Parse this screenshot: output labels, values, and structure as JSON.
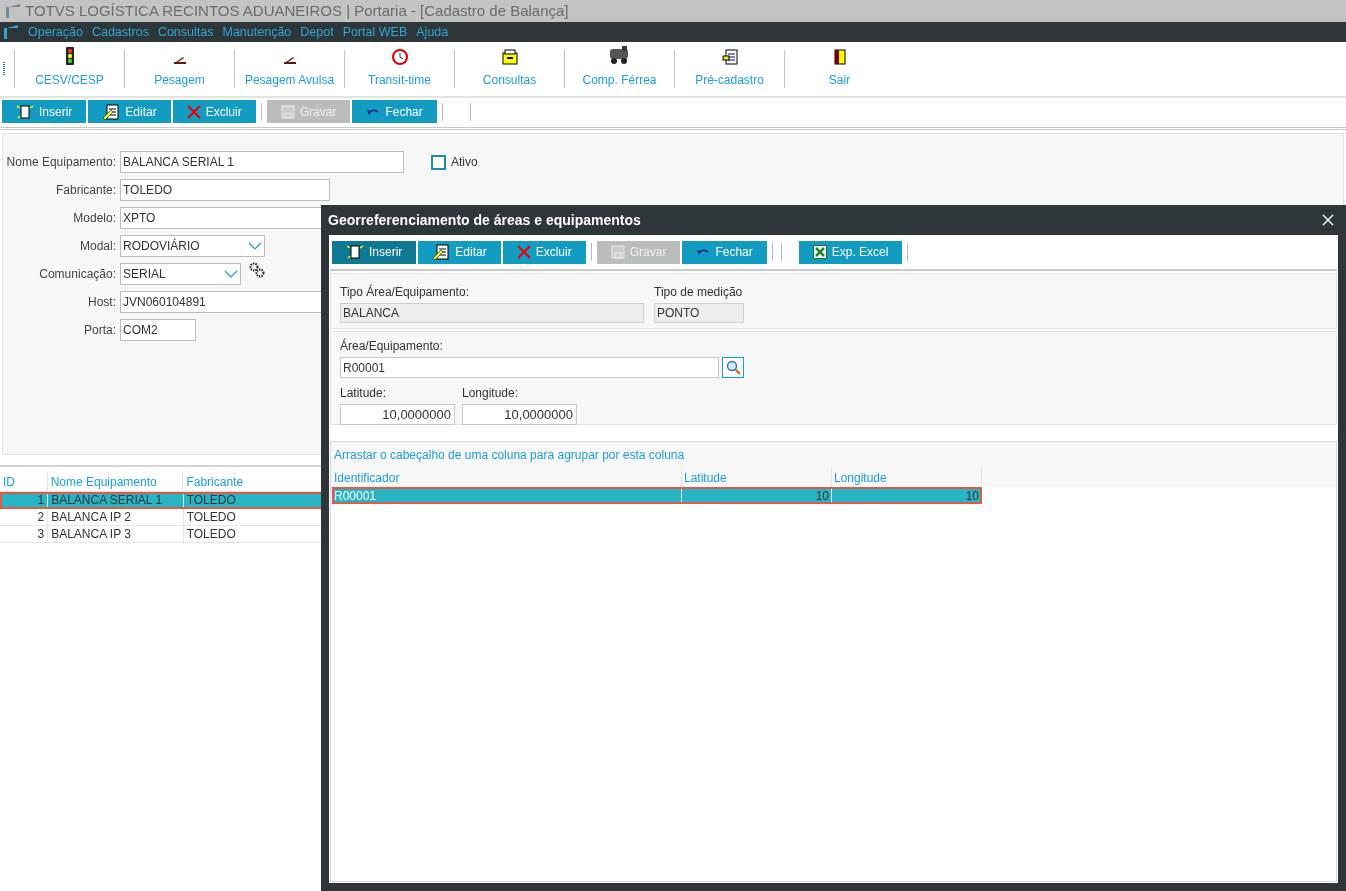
{
  "window": {
    "title": "TOTVS LOGÍSTICA RECINTOS ADUANEIROS | Portaria - [Cadastro de Balança]"
  },
  "menu": [
    "Operação",
    "Cadastros",
    "Consultas",
    "Manutenção",
    "Depot",
    "Portal WEB",
    "Ajuda"
  ],
  "toolbar": [
    {
      "kind": "traffic",
      "label": "CESV/CESP"
    },
    {
      "kind": "scale",
      "label": "Pesagem"
    },
    {
      "kind": "scale",
      "label": "Pesagem Avulsa"
    },
    {
      "kind": "clock",
      "label": "Transit-time"
    },
    {
      "kind": "drawer",
      "label": "Consultas"
    },
    {
      "kind": "train",
      "label": "Comp. Férrea"
    },
    {
      "kind": "form",
      "label": "Pré-cadastro"
    },
    {
      "kind": "door",
      "label": "Sair"
    }
  ],
  "actions": [
    {
      "kind": "insert",
      "label": "Inserir",
      "disabled": false
    },
    {
      "kind": "edit",
      "label": "Editar",
      "disabled": false
    },
    {
      "kind": "delete",
      "label": "Excluir",
      "disabled": false
    },
    {
      "kind": "save",
      "label": "Gravar",
      "disabled": true
    },
    {
      "kind": "close",
      "label": "Fechar",
      "disabled": false
    }
  ],
  "form": {
    "fields": [
      {
        "label": "Nome Equipamento:",
        "value": "BALANCA SERIAL 1",
        "kind": "text"
      },
      {
        "label": "Fabricante:",
        "value": "TOLEDO",
        "kind": "text"
      },
      {
        "label": "Modelo:",
        "value": "XPTO",
        "kind": "text"
      },
      {
        "label": "Modal:",
        "value": "RODOVIÁRIO",
        "kind": "select"
      },
      {
        "label": "Comunicação:",
        "value": "SERIAL",
        "kind": "select_gear"
      },
      {
        "label": "Host:",
        "value": "JVN060104891",
        "kind": "text"
      },
      {
        "label": "Porta:",
        "value": "COM2",
        "kind": "text"
      }
    ],
    "ativo": {
      "label": "Ativo",
      "checked": false
    }
  },
  "table": {
    "columns": [
      "ID",
      "Nome Equipamento",
      "Fabricante"
    ],
    "rows": [
      {
        "cells": [
          "1",
          "BALANCA SERIAL 1",
          "TOLEDO"
        ],
        "selected": true
      },
      {
        "cells": [
          "2",
          "BALANCA IP 2",
          "TOLEDO"
        ],
        "selected": false
      },
      {
        "cells": [
          "3",
          "BALANCA IP 3",
          "TOLEDO"
        ],
        "selected": false
      }
    ]
  },
  "dialog": {
    "title": "Georreferenciamento de áreas e equipamentos",
    "actions": [
      {
        "kind": "insert",
        "label": "Inserir",
        "disabled": false,
        "focused": true
      },
      {
        "kind": "edit",
        "label": "Editar",
        "disabled": false,
        "focused": false
      },
      {
        "kind": "delete",
        "label": "Excluir",
        "disabled": false,
        "focused": false
      },
      {
        "kind": "save",
        "label": "Gravar",
        "disabled": true,
        "focused": false
      },
      {
        "kind": "close",
        "label": "Fechar",
        "disabled": false,
        "focused": false
      },
      {
        "kind": "excel",
        "label": "Exp. Excel",
        "disabled": false,
        "focused": false
      }
    ],
    "tipo_area": {
      "label": "Tipo Área/Equipamento:",
      "value": "BALANCA"
    },
    "tipo_medicao": {
      "label": "Tipo de medição",
      "value": "PONTO"
    },
    "area": {
      "label": "Área/Equipamento:",
      "value": "R00001"
    },
    "latitude": {
      "label": "Latitude:",
      "value": "10,0000000"
    },
    "longitude": {
      "label": "Longitude:",
      "value": "10,0000000"
    },
    "group_hint": "Arrastar o cabeçalho de uma coluna para agrupar por esta coluna",
    "grid": {
      "columns": [
        "Identificador",
        "Latitude",
        "Longitude"
      ],
      "rows": [
        {
          "cells": [
            "R00001",
            "10",
            "10"
          ],
          "selected": true
        }
      ]
    }
  }
}
